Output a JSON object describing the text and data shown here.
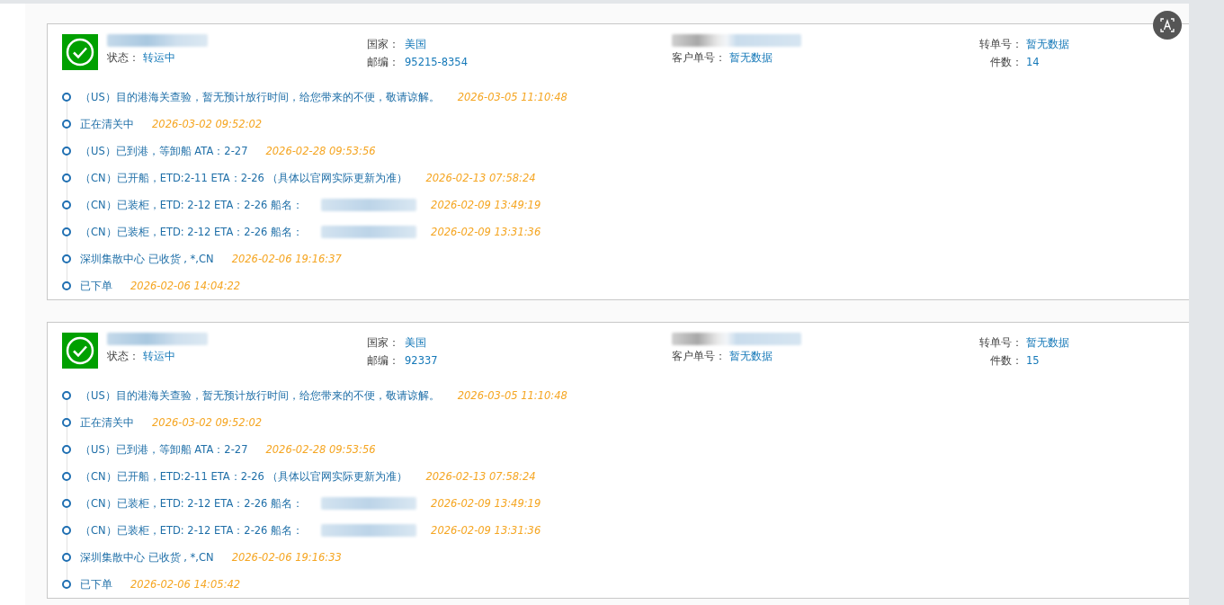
{
  "cards": [
    {
      "status_label": "状态：",
      "status": "转运中",
      "country_label": "国家：",
      "country": "美国",
      "zip_label": "邮编：",
      "zip": "95215-8354",
      "customer_no_label": "客户单号：",
      "customer_no": "暂无数据",
      "transfer_no_label": "转单号：",
      "transfer_no": "暂无数据",
      "pieces_label": "件数：",
      "pieces": "14",
      "events": [
        {
          "text": "（US）目的港海关查验，暂无预计放行时间，给您带来的不便，敬请谅解。",
          "time": "2026-03-05 11:10:48",
          "redacted": false
        },
        {
          "text": "正在清关中",
          "time": "2026-03-02 09:52:02",
          "redacted": false
        },
        {
          "text": "（US）已到港，等卸船 ATA：2-27",
          "time": "2026-02-28 09:53:56",
          "redacted": false
        },
        {
          "text": "（CN）已开船，ETD:2-11 ETA：2-26 （具体以官网实际更新为准）",
          "time": "2026-02-13 07:58:24",
          "redacted": false
        },
        {
          "text": "（CN）已装柜，ETD: 2-12 ETA：2-26 船名：",
          "time": "2026-02-09 13:49:19",
          "redacted": true
        },
        {
          "text": "（CN）已装柜，ETD: 2-12 ETA：2-26 船名：",
          "time": "2026-02-09 13:31:36",
          "redacted": true
        },
        {
          "text": "深圳集散中心 已收货 , *,CN",
          "time": "2026-02-06 19:16:37",
          "redacted": false
        },
        {
          "text": "已下单",
          "time": "2026-02-06 14:04:22",
          "redacted": false
        }
      ]
    },
    {
      "status_label": "状态：",
      "status": "转运中",
      "country_label": "国家：",
      "country": "美国",
      "zip_label": "邮编：",
      "zip": "92337",
      "customer_no_label": "客户单号：",
      "customer_no": "暂无数据",
      "transfer_no_label": "转单号：",
      "transfer_no": "暂无数据",
      "pieces_label": "件数：",
      "pieces": "15",
      "events": [
        {
          "text": "（US）目的港海关查验，暂无预计放行时间，给您带来的不便，敬请谅解。",
          "time": "2026-03-05 11:10:48",
          "redacted": false
        },
        {
          "text": "正在清关中",
          "time": "2026-03-02 09:52:02",
          "redacted": false
        },
        {
          "text": "（US）已到港，等卸船 ATA：2-27",
          "time": "2026-02-28 09:53:56",
          "redacted": false
        },
        {
          "text": "（CN）已开船，ETD:2-11 ETA：2-26 （具体以官网实际更新为准）",
          "time": "2026-02-13 07:58:24",
          "redacted": false
        },
        {
          "text": "（CN）已装柜，ETD: 2-12 ETA：2-26 船名：",
          "time": "2026-02-09 13:49:19",
          "redacted": true
        },
        {
          "text": "（CN）已装柜，ETD: 2-12 ETA：2-26 船名：",
          "time": "2026-02-09 13:31:36",
          "redacted": true
        },
        {
          "text": "深圳集散中心 已收货 , *,CN",
          "time": "2026-02-06 19:16:33",
          "redacted": false
        },
        {
          "text": "已下单",
          "time": "2026-02-06 14:05:42",
          "redacted": false
        }
      ]
    }
  ]
}
